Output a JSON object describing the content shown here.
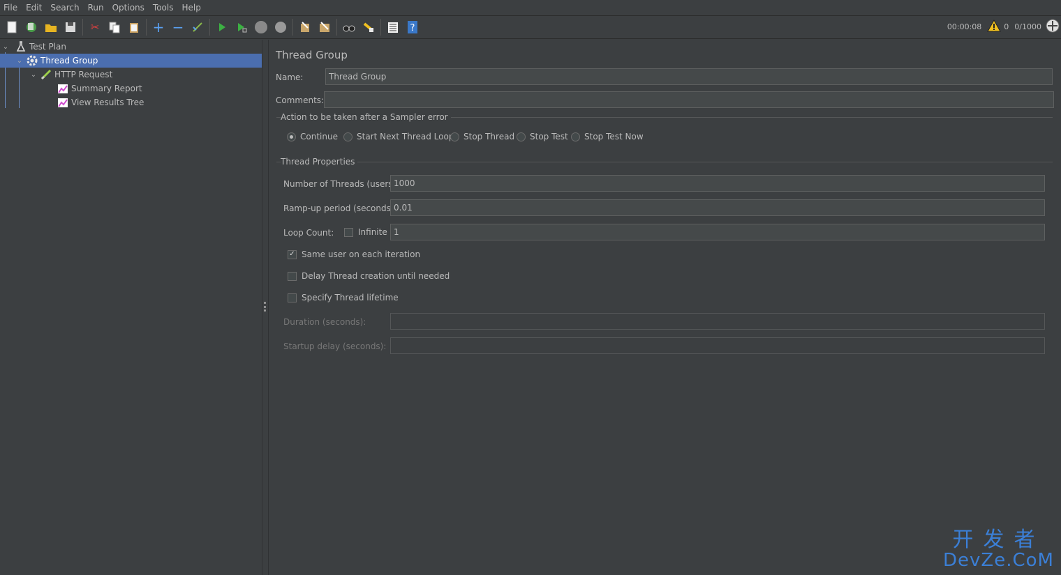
{
  "menu": [
    "File",
    "Edit",
    "Search",
    "Run",
    "Options",
    "Tools",
    "Help"
  ],
  "toolbar": {
    "icons": [
      "new-icon",
      "templates-icon",
      "open-icon",
      "save-icon",
      "cut-icon",
      "copy-icon",
      "paste-icon",
      "expand-icon",
      "collapse-icon",
      "toggle-icon",
      "start-icon",
      "start-no-pause-icon",
      "stop-icon",
      "shutdown-icon",
      "clear-icon",
      "clear-all-icon",
      "search-icon",
      "reset-search-icon",
      "function-helper-icon",
      "help-icon"
    ]
  },
  "status": {
    "elapsed": "00:00:08",
    "warnings": "0",
    "threads": "0/1000"
  },
  "tree": {
    "items": [
      {
        "label": "Test Plan",
        "icon": "test-plan-icon"
      },
      {
        "label": "Thread Group",
        "icon": "thread-group-icon"
      },
      {
        "label": "HTTP Request",
        "icon": "sampler-icon"
      },
      {
        "label": "Summary Report",
        "icon": "listener-icon"
      },
      {
        "label": "View Results Tree",
        "icon": "listener-icon"
      }
    ]
  },
  "panel": {
    "title": "Thread Group",
    "name_label": "Name:",
    "name_value": "Thread Group",
    "comments_label": "Comments:",
    "comments_value": "",
    "sampler_error": {
      "title": "Action to be taken after a Sampler error",
      "options": [
        "Continue",
        "Start Next Thread Loop",
        "Stop Thread",
        "Stop Test",
        "Stop Test Now"
      ],
      "selected": "Continue"
    },
    "thread_props": {
      "title": "Thread Properties",
      "threads_label": "Number of Threads (users):",
      "threads_value": "1000",
      "rampup_label": "Ramp-up period (seconds):",
      "rampup_value": "0.01",
      "loop_label": "Loop Count:",
      "infinite_label": "Infinite",
      "loop_value": "1",
      "same_user_label": "Same user on each iteration",
      "delay_label": "Delay Thread creation until needed",
      "lifetime_label": "Specify Thread lifetime",
      "duration_label": "Duration (seconds):",
      "startup_label": "Startup delay (seconds):"
    }
  },
  "watermark": {
    "line1": "开发者",
    "line2": "DevZe.CoM"
  },
  "colors": {
    "background": "#3c3f41",
    "selection": "#4b6eaf",
    "field": "#45494a",
    "watermark": "#3b7fd6"
  }
}
